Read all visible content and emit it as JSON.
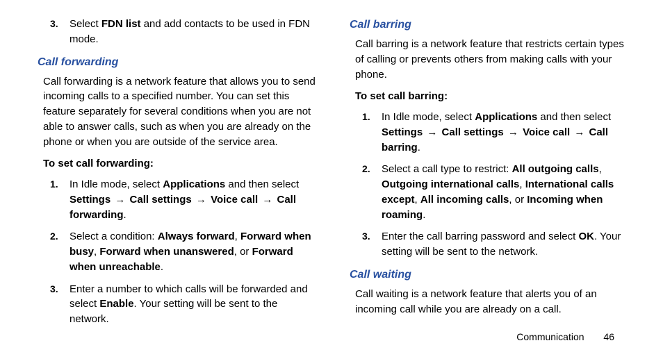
{
  "left": {
    "fdn_step3_pre": "Select ",
    "fdn_step3_bold": "FDN list",
    "fdn_step3_post": " and add contacts to be used in FDN mode.",
    "cf_heading": "Call forwarding",
    "cf_para": "Call forwarding is a network feature that allows you to send incoming calls to a specified number. You can set this feature separately for several conditions when you are not able to answer calls, such as when you are already on the phone or when you are outside of the service area.",
    "cf_sub": "To set call forwarding:",
    "cf_s1_a": "In Idle mode, select ",
    "cf_s1_apps": "Applications",
    "cf_s1_b": " and then select ",
    "cf_s1_settings": "Settings",
    "cf_s1_arrow": " → ",
    "cf_s1_callsettings": "Call settings",
    "cf_s1_voice": "Voice call",
    "cf_s1_cf": "Call forwarding",
    "cf_s1_dot": ".",
    "cf_s2_a": "Select a condition: ",
    "cf_s2_always": "Always forward",
    "cf_s2_c1": ", ",
    "cf_s2_busy": "Forward when busy",
    "cf_s2_unans": "Forward when unanswered",
    "cf_s2_or": ", or ",
    "cf_s2_unreach": "Forward when unreachable",
    "cf_s3_a": "Enter a number to which calls will be forwarded and select ",
    "cf_s3_enable": "Enable",
    "cf_s3_b": ". Your setting will be sent to the network."
  },
  "right": {
    "cb_heading": "Call barring",
    "cb_para": "Call barring is a network feature that restricts certain types of calling or prevents others from making calls with your phone.",
    "cb_sub": "To set call barring:",
    "cb_s1_a": "In Idle mode, select ",
    "cb_s1_apps": "Applications",
    "cb_s1_b": " and then select ",
    "cb_s1_settings": "Settings",
    "cb_s1_arrow": " → ",
    "cb_s1_callsettings": "Call settings",
    "cb_s1_voice": "Voice call",
    "cb_s1_cb": "Call barring",
    "cb_s1_dot": ".",
    "cb_s2_a": "Select a call type to restrict: ",
    "cb_s2_allout": "All outgoing calls",
    "cb_s2_c": ", ",
    "cb_s2_outintl": "Outgoing international calls",
    "cb_s2_intlexcept": "International calls except",
    "cb_s2_allin": "All incoming calls",
    "cb_s2_or": ", or ",
    "cb_s2_inroam": "Incoming when roaming",
    "cb_s2_dot": ".",
    "cb_s3_a": "Enter the call barring password and select ",
    "cb_s3_ok": "OK",
    "cb_s3_b": ". Your setting will be sent to the network.",
    "cw_heading": "Call waiting",
    "cw_para": "Call waiting is a network feature that alerts you of an incoming call while you are already on a call."
  },
  "footer": {
    "section": "Communication",
    "page": "46"
  },
  "nums": {
    "n1": "1.",
    "n2": "2.",
    "n3": "3."
  }
}
